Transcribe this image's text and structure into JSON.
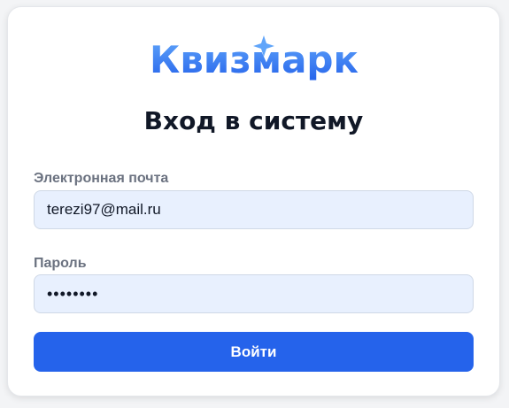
{
  "brand": {
    "name": "Квизмарк",
    "gradient_start": "#2563eb",
    "gradient_end": "#60a5fa",
    "sparkle_color": "#60a5fa"
  },
  "login": {
    "title": "Вход в систему",
    "email_label": "Электронная почта",
    "email_value": "terezi97@mail.ru",
    "password_label": "Пароль",
    "password_value": "12345678",
    "submit_label": "Войти"
  },
  "colors": {
    "accent": "#2563eb",
    "input_bg": "#e8f0fe",
    "label": "#6b7280",
    "title": "#111827"
  }
}
